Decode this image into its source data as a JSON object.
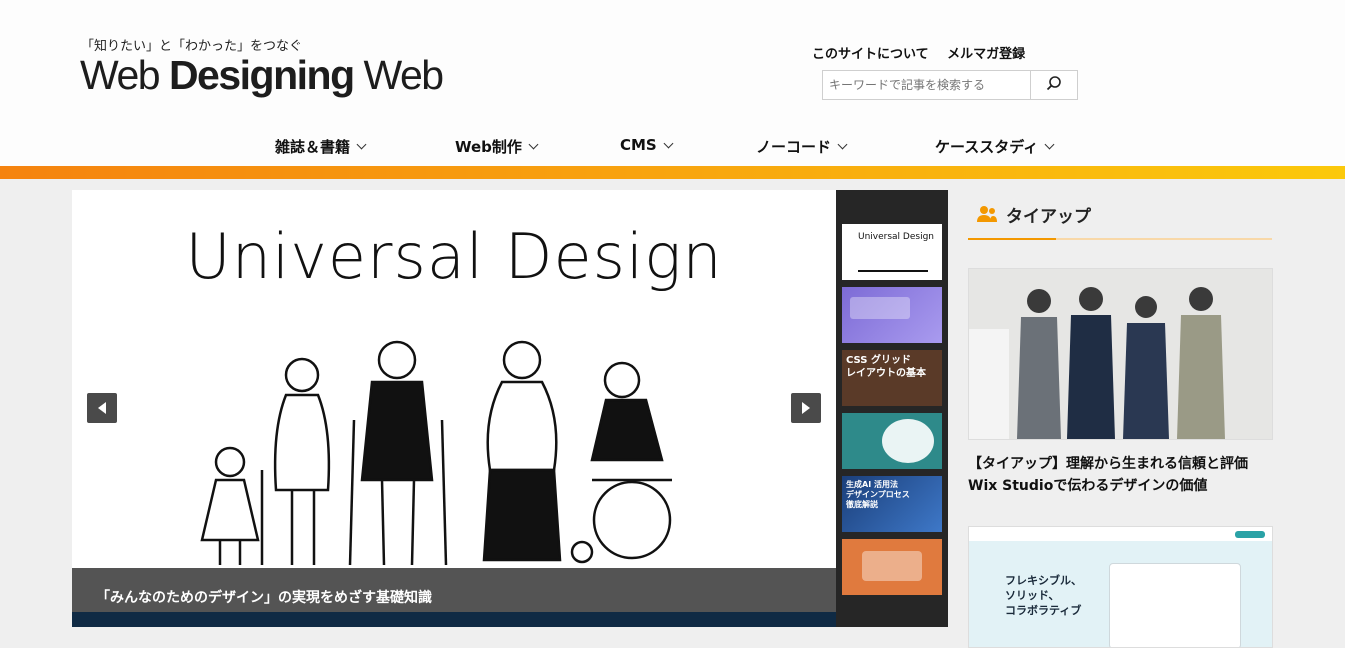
{
  "header": {
    "tagline": "「知りたい」と「わかった」をつなぐ",
    "logo_part1": "Web ",
    "logo_part2": "Designing",
    "logo_part3": " Web",
    "links": [
      "このサイトについて",
      "メルマガ登録"
    ],
    "search_placeholder": "キーワードで記事を検索する",
    "search_icon": "search-icon"
  },
  "nav": {
    "items": [
      "雑誌＆書籍",
      "Web制作",
      "CMS",
      "ノーコード",
      "ケーススタディ"
    ]
  },
  "colors": {
    "accent": "#f39800",
    "bar_start": "#f5830f",
    "bar_end": "#fbc90c",
    "caption_bg": "#3c3c3c"
  },
  "slider": {
    "title": "Universal Design",
    "caption": "「みんなのためのデザイン」の実現をめざす基礎知識",
    "prev_icon": "prev-arrow-icon",
    "next_icon": "next-arrow-icon",
    "thumbs": [
      {
        "text": "Universal Design"
      },
      {
        "text": ""
      },
      {
        "text": "CSS グリッド\nレイアウトの基本"
      },
      {
        "text": ""
      },
      {
        "text": "生成AI 活用法\nデザインプロセス\n徹底解説"
      },
      {
        "text": ""
      }
    ]
  },
  "sidebar": {
    "heading": "タイアップ",
    "heading_icon": "users-icon",
    "card1_title": "【タイアップ】理解から生まれる信頼と評価 Wix Studioで伝わるデザインの価値",
    "card2_text1": "フレキシブル、",
    "card2_text2": "ソリッド、",
    "card2_text3": "コラボラティブ"
  }
}
